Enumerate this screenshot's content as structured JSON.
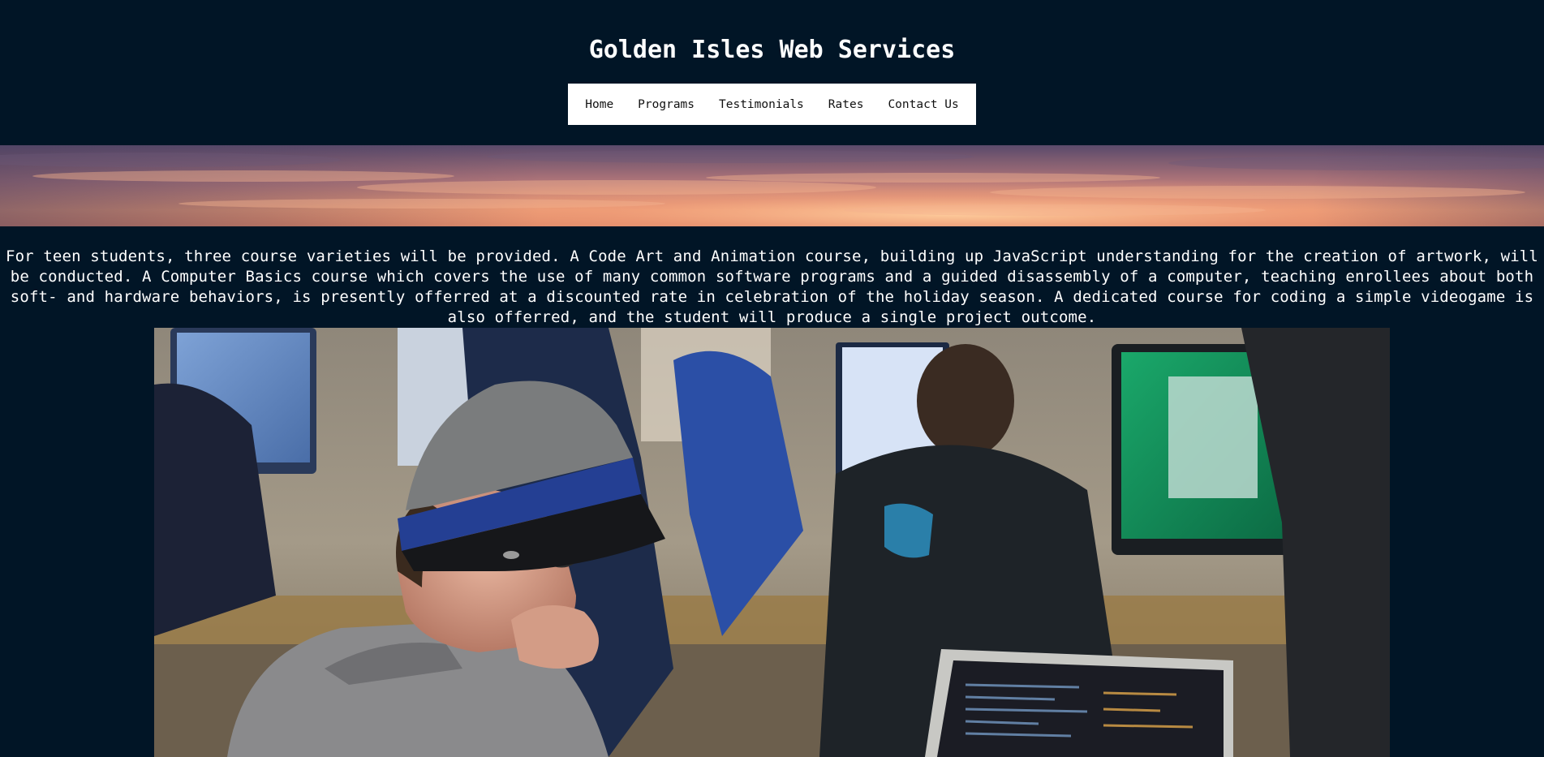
{
  "header": {
    "title": "Golden Isles Web Services"
  },
  "nav": {
    "items": [
      {
        "label": "Home"
      },
      {
        "label": "Programs"
      },
      {
        "label": "Testimonials"
      },
      {
        "label": "Rates"
      },
      {
        "label": "Contact Us"
      }
    ]
  },
  "content": {
    "intro": "For teen students, three course varieties will be provided. A Code Art and Animation course, building up JavaScript understanding for the creation of artwork, will be conducted. A Computer Basics course which covers the use of many common software programs and a guided disassembly of a computer, teaching enrollees about both soft- and hardware behaviors, is presently offerred at a discounted rate in celebration of the holiday season. A dedicated course for coding a simple videogame is also offerred, and the student will produce a single project outcome."
  },
  "colors": {
    "page_background": "#011526",
    "nav_background": "#ffffff",
    "text": "#ffffff"
  }
}
